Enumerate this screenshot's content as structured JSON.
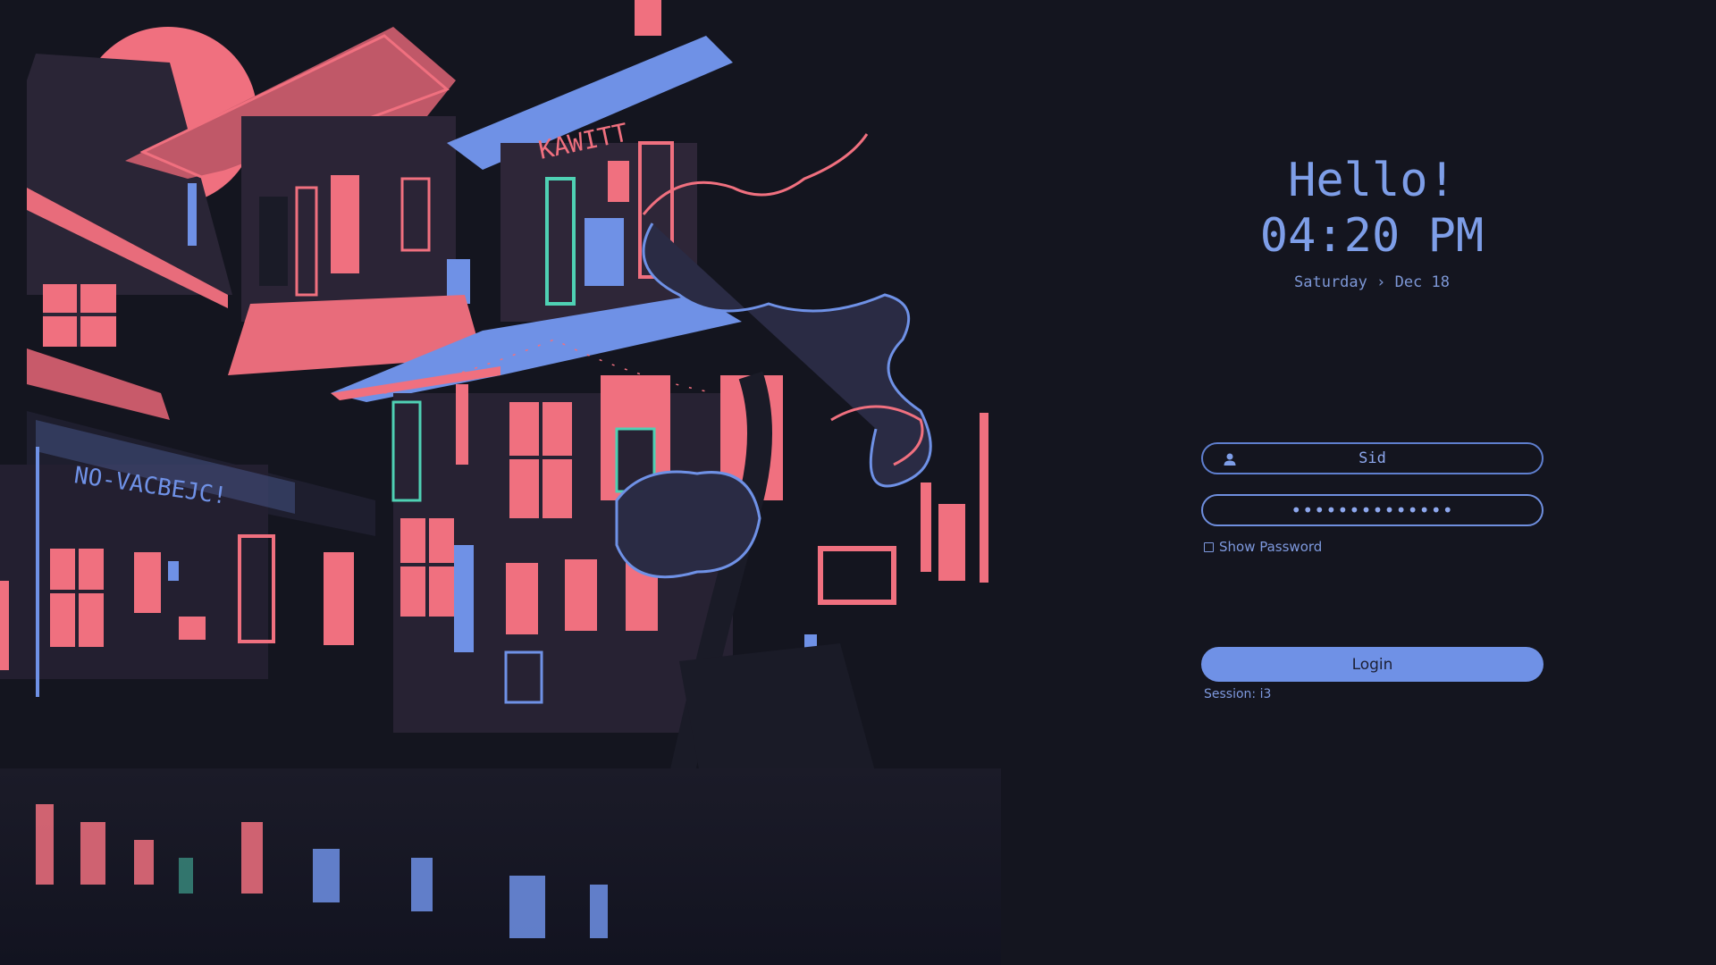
{
  "greeting": {
    "hello": "Hello!",
    "time": "04:20 PM",
    "date": "Saturday › Dec 18"
  },
  "login": {
    "username": "Sid",
    "password_mask": "••••••••••••••",
    "show_password_label": "Show Password",
    "show_password_checked": false,
    "button_label": "Login",
    "session": "Session: i3"
  },
  "artwork": {
    "sign_top": "KAWITT",
    "sign_left": "NO-VACBEJC!"
  },
  "icons": {
    "user": "user-icon",
    "checkbox": "checkbox-icon"
  },
  "colors": {
    "background": "#14151f",
    "accent_blue": "#6f91e6",
    "accent_pink": "#f0707f",
    "accent_teal": "#4fd1b4",
    "text_blue": "#7e9ee8"
  }
}
